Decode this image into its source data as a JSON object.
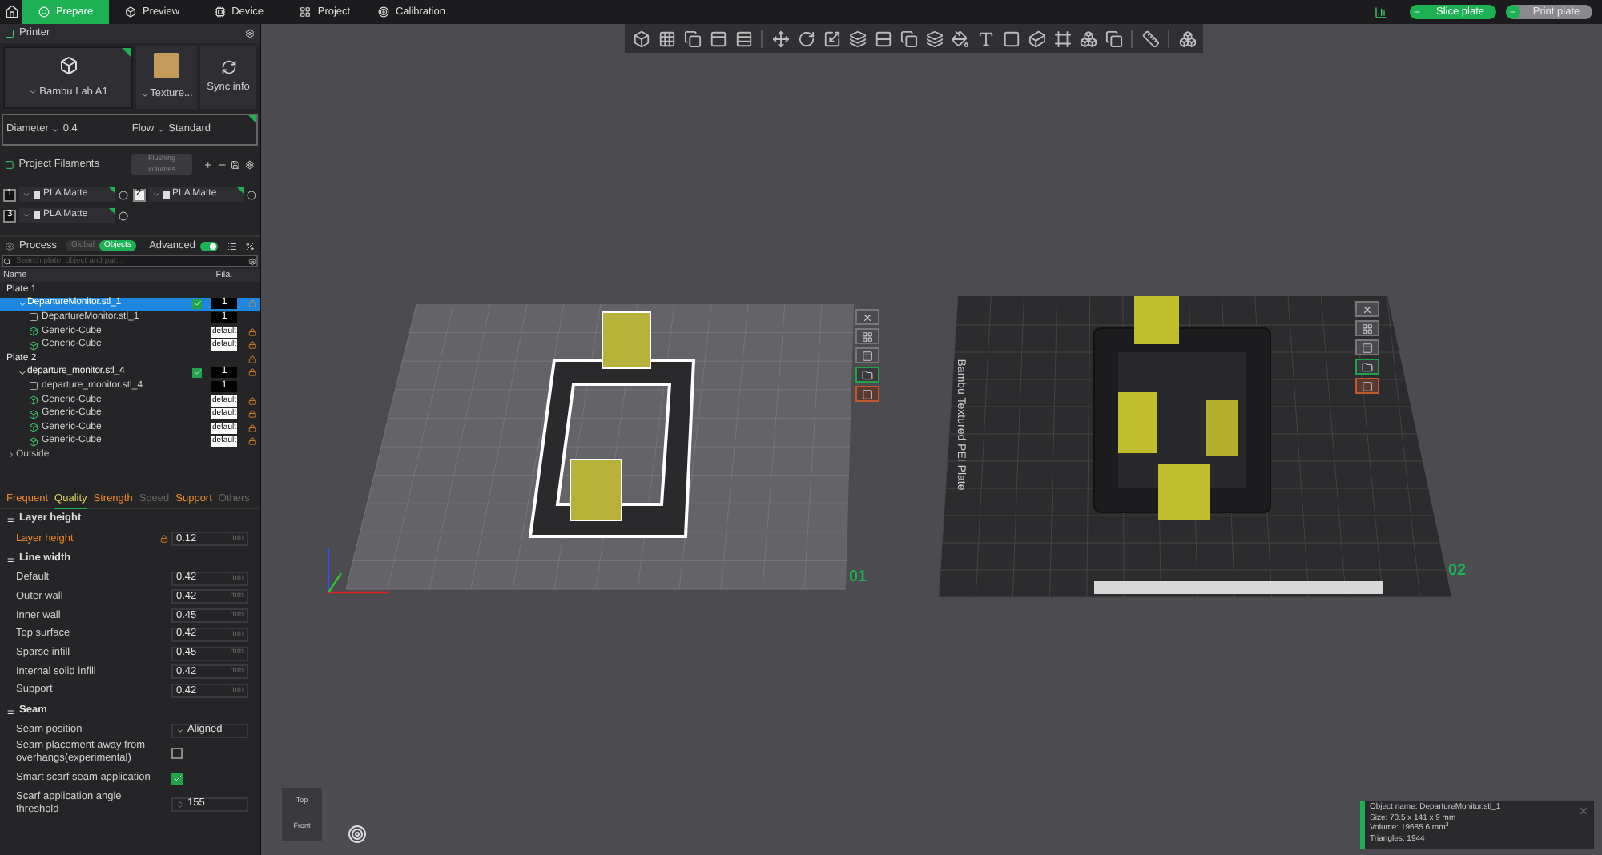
{
  "top_tabs": [
    {
      "label": "Prepare",
      "selected": true
    },
    {
      "label": "Preview",
      "selected": false
    },
    {
      "label": "Device",
      "selected": false
    },
    {
      "label": "Project",
      "selected": false
    },
    {
      "label": "Calibration",
      "selected": false
    }
  ],
  "top_actions": [
    {
      "label": "Slice plate",
      "enabled": true
    },
    {
      "label": "Print plate",
      "enabled": false
    }
  ],
  "printer": {
    "title": "Printer",
    "printer_name": "Bambu Lab A1",
    "plate_type": "Texture...",
    "sync": "Sync info",
    "diameter_label": "Diameter",
    "diameter": "0.4",
    "flow_label": "Flow",
    "flow": "Standard"
  },
  "filaments": {
    "title": "Project Filaments",
    "flushing": "Flushing volumes",
    "items": [
      {
        "index": "1",
        "name": "PLA Matte",
        "color": "#111111"
      },
      {
        "index": "2",
        "name": "PLA Matte",
        "color": "#f2f2f2"
      },
      {
        "index": "3",
        "name": "PLA Matte",
        "color": "#111111"
      }
    ]
  },
  "process": {
    "title": "Process",
    "modes": [
      {
        "label": "Global",
        "selected": false
      },
      {
        "label": "Objects",
        "selected": true
      }
    ],
    "advanced_label": "Advanced",
    "advanced": true,
    "search_placeholder": "Search plate, object and par...",
    "columns": [
      "Name",
      "Fila."
    ],
    "tree": [
      {
        "label": "Plate 1",
        "kind": "plate",
        "locked": false,
        "children": [
          {
            "label": "DepartureMonitor.stl_1",
            "kind": "object",
            "selected": true,
            "expanded": true,
            "visible": true,
            "filament": "1",
            "locked": true,
            "children": [
              {
                "label": "DepartureMonitor.stl_1",
                "kind": "part",
                "selected": false,
                "filament": "1",
                "locked": false
              },
              {
                "label": "Generic-Cube",
                "kind": "modifier",
                "selected": false,
                "filament": "default",
                "locked": true
              },
              {
                "label": "Generic-Cube",
                "kind": "modifier",
                "selected": false,
                "filament": "default",
                "locked": true
              }
            ]
          }
        ]
      },
      {
        "label": "Plate 2",
        "kind": "plate",
        "locked": true,
        "children": [
          {
            "label": "departure_monitor.stl_4",
            "kind": "object",
            "selected": false,
            "expanded": true,
            "visible": true,
            "filament": "1",
            "locked": true,
            "children": [
              {
                "label": "departure_monitor.stl_4",
                "kind": "part",
                "selected": false,
                "filament": "1",
                "locked": false
              },
              {
                "label": "Generic-Cube",
                "kind": "modifier",
                "selected": false,
                "filament": "default",
                "locked": true
              },
              {
                "label": "Generic-Cube",
                "kind": "modifier",
                "selected": false,
                "filament": "default",
                "locked": true
              },
              {
                "label": "Generic-Cube",
                "kind": "modifier",
                "selected": false,
                "filament": "default",
                "locked": true
              },
              {
                "label": "Generic-Cube",
                "kind": "modifier",
                "selected": false,
                "filament": "default",
                "locked": true
              }
            ]
          }
        ]
      },
      {
        "label": "Outside",
        "kind": "section",
        "expanded": false,
        "locked": false
      }
    ]
  },
  "settings_tabs": [
    {
      "label": "Frequent",
      "selected": false,
      "modified": true
    },
    {
      "label": "Quality",
      "selected": true,
      "modified": true
    },
    {
      "label": "Strength",
      "selected": false,
      "modified": true
    },
    {
      "label": "Speed",
      "selected": false,
      "modified": false
    },
    {
      "label": "Support",
      "selected": false,
      "modified": true
    },
    {
      "label": "Others",
      "selected": false,
      "modified": false
    }
  ],
  "settings_groups": [
    {
      "title": "Layer height",
      "rows": [
        {
          "kind": "number",
          "label": "Layer height",
          "value": "0.12",
          "unit": "mm",
          "modified": true
        }
      ]
    },
    {
      "title": "Line width",
      "rows": [
        {
          "kind": "number",
          "label": "Default",
          "value": "0.42",
          "unit": "mm",
          "modified": false
        },
        {
          "kind": "number",
          "label": "Outer wall",
          "value": "0.42",
          "unit": "mm",
          "modified": false
        },
        {
          "kind": "number",
          "label": "Inner wall",
          "value": "0.45",
          "unit": "mm",
          "modified": false
        },
        {
          "kind": "number",
          "label": "Top surface",
          "value": "0.42",
          "unit": "mm",
          "modified": false
        },
        {
          "kind": "number",
          "label": "Sparse infill",
          "value": "0.45",
          "unit": "mm",
          "modified": false
        },
        {
          "kind": "number",
          "label": "Internal solid infill",
          "value": "0.42",
          "unit": "mm",
          "modified": false
        },
        {
          "kind": "number",
          "label": "Support",
          "value": "0.42",
          "unit": "mm",
          "modified": false
        }
      ]
    },
    {
      "title": "Seam",
      "rows": [
        {
          "kind": "dropdown",
          "label": "Seam position",
          "value": "Aligned",
          "modified": false
        },
        {
          "kind": "checkbox",
          "label": "Seam placement away from overhangs(experimental)",
          "checked": false,
          "modified": false
        },
        {
          "kind": "checkbox",
          "label": "Smart scarf seam application",
          "checked": true,
          "modified": false
        },
        {
          "kind": "spin",
          "label": "Scarf application angle threshold",
          "value": "155",
          "modified": false
        }
      ]
    }
  ],
  "viewport": {
    "plate_labels": [
      "01",
      "02"
    ],
    "plate_name": "Bambu Textured PEI Plate",
    "view_cube": {
      "top": "Top",
      "front": "Front"
    }
  },
  "object_info": [
    "Object name: DepartureMonitor.stl_1",
    "Size: 70.5 x 141 x 9 mm",
    "Volume: 19685.6 mm$^{3}$",
    "Triangles: 1944"
  ]
}
